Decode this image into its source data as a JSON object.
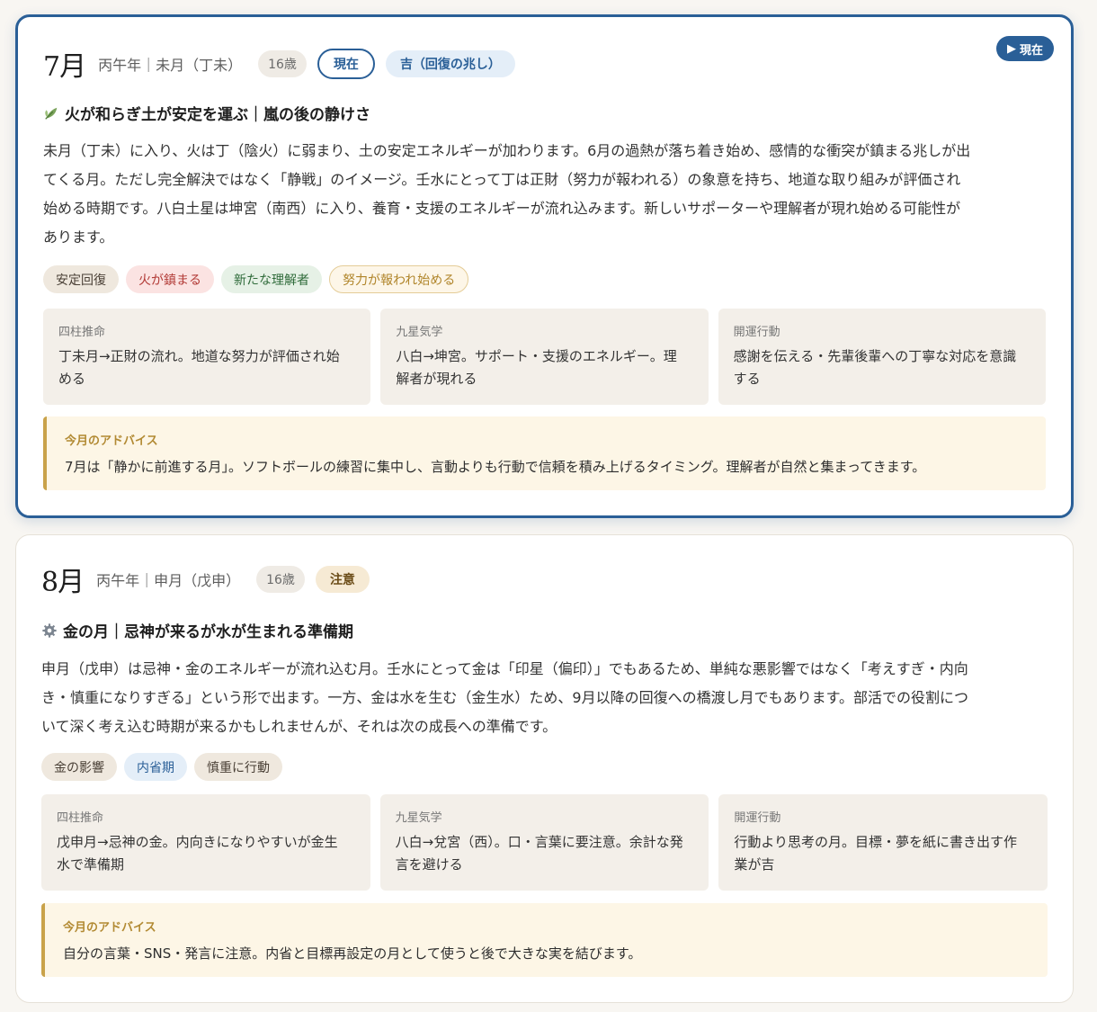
{
  "cards": [
    {
      "month": "7月",
      "ganzhi": "丙午年｜未月（丁未）",
      "age": "16歳",
      "now_pill": "現在",
      "luck_pill": "吉（回復の兆し）",
      "now_badge": "現在",
      "icon": "leaf-icon",
      "subtitle": "火が和らぎ土が安定を運ぶ｜嵐の後の静けさ",
      "body_lines": [
        "未月（丁未）に入り、火は丁（陰火）に弱まり、土の安定エネルギーが加わります。6月の過熱が落ち着き始め、感情的な衝突が鎮まる兆しが出",
        "てくる月。ただし完全解決ではなく「静戦」のイメージ。壬水にとって丁は正財（努力が報われる）の象意を持ち、地道な取り組みが評価され",
        "始める時期です。八白土星は坤宮（南西）に入り、養育・支援のエネルギーが流れ込みます。新しいサポーターや理解者が現れ始める可能性が",
        "あります。"
      ],
      "tags": [
        "安定回復",
        "火が鎮まる",
        "新たな理解者",
        "努力が報われ始める"
      ],
      "boxes": [
        {
          "title": "四柱推命",
          "lines": [
            "丁未月→正財の流れ。地道な努力が評価され始",
            "める"
          ]
        },
        {
          "title": "九星気学",
          "lines": [
            "八白→坤宮。サポート・支援のエネルギー。理",
            "解者が現れる"
          ]
        },
        {
          "title": "開運行動",
          "lines": [
            "感謝を伝える・先輩後輩への丁寧な対応を意識",
            "する"
          ]
        }
      ],
      "advice_title": "今月のアドバイス",
      "advice_text": "7月は「静かに前進する月」。ソフトボールの練習に集中し、言動よりも行動で信頼を積み上げるタイミング。理解者が自然と集まってきます。"
    },
    {
      "month": "8月",
      "ganzhi": "丙午年｜申月（戊申）",
      "age": "16歳",
      "caution_pill": "注意",
      "icon": "gear-icon",
      "subtitle": "金の月｜忌神が来るが水が生まれる準備期",
      "body_lines": [
        "申月（戊申）は忌神・金のエネルギーが流れ込む月。壬水にとって金は「印星（偏印）」でもあるため、単純な悪影響ではなく「考えすぎ・内向",
        "き・慎重になりすぎる」という形で出ます。一方、金は水を生む（金生水）ため、9月以降の回復への橋渡し月でもあります。部活での役割につ",
        "いて深く考え込む時期が来るかもしれませんが、それは次の成長への準備です。"
      ],
      "tags": [
        "金の影響",
        "内省期",
        "慎重に行動"
      ],
      "boxes": [
        {
          "title": "四柱推命",
          "lines": [
            "戊申月→忌神の金。内向きになりやすいが金生",
            "水で準備期"
          ]
        },
        {
          "title": "九星気学",
          "lines": [
            "八白→兌宮（西）。口・言葉に要注意。余計な発",
            "言を避ける"
          ]
        },
        {
          "title": "開運行動",
          "lines": [
            "行動より思考の月。目標・夢を紙に書き出す作",
            "業が吉"
          ]
        }
      ],
      "advice_title": "今月のアドバイス",
      "advice_text": "自分の言葉・SNS・発言に注意。内省と目標再設定の月として使うと後で大きな実を結びます。"
    }
  ]
}
